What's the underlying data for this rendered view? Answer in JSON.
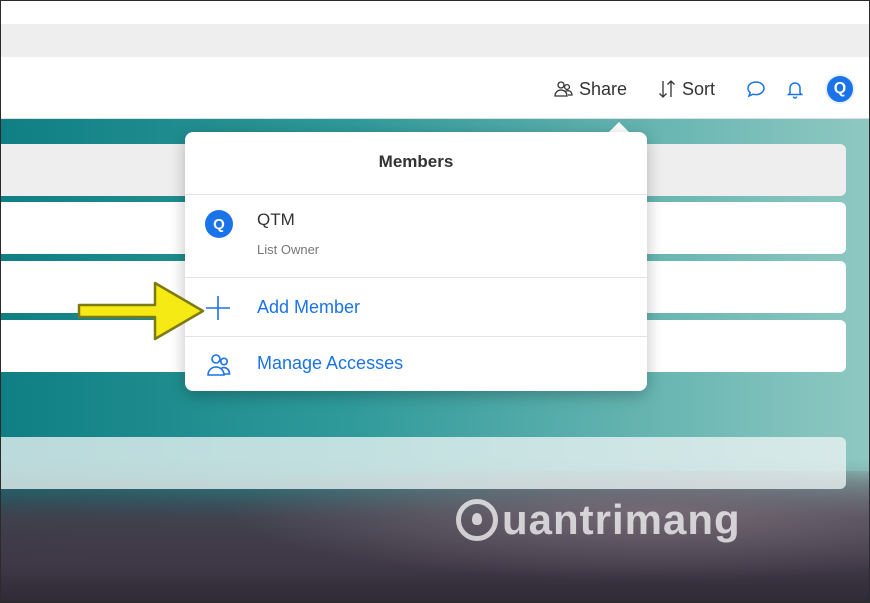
{
  "toolbar": {
    "share_label": "Share",
    "sort_label": "Sort",
    "user_initial": "Q",
    "icons": [
      "share-people-icon",
      "sort-icon",
      "comment-icon",
      "bell-icon"
    ],
    "accent": "#1a73e8"
  },
  "members_popup": {
    "title": "Members",
    "members": [
      {
        "initial": "Q",
        "name": "QTM",
        "role": "List Owner"
      }
    ],
    "actions": [
      {
        "label": "Add Member",
        "icon": "plus-icon"
      },
      {
        "label": "Manage Accesses",
        "icon": "people-icon"
      }
    ]
  },
  "watermark": {
    "text": "uantrimang"
  }
}
